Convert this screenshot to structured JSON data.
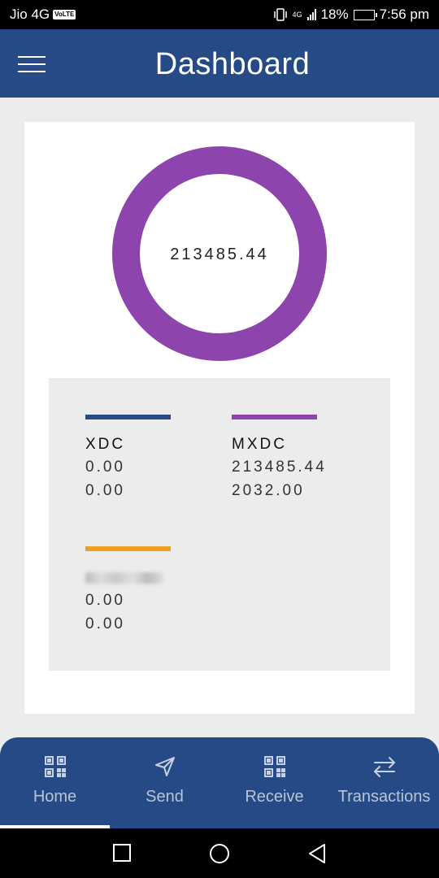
{
  "status_bar": {
    "carrier": "Jio 4G",
    "volte": "VoLTE",
    "network": "4G",
    "battery_percent": "18%",
    "time": "7:56 pm"
  },
  "header": {
    "title": "Dashboard"
  },
  "summary": {
    "total": "213485.44",
    "ring_color": "#8e44ad"
  },
  "assets": [
    {
      "name": "XDC",
      "color": "#254a86",
      "line1": "0.00",
      "line2": "0.00"
    },
    {
      "name": "MXDC",
      "color": "#8e44ad",
      "line1": "213485.44",
      "line2": "2032.00"
    },
    {
      "name": "",
      "color": "#f0a020",
      "line1": "0.00",
      "line2": "0.00"
    }
  ],
  "bottom_nav": {
    "items": [
      {
        "label": "Home",
        "icon": "qr-code-icon",
        "active": true
      },
      {
        "label": "Send",
        "icon": "send-arrow-icon",
        "active": false
      },
      {
        "label": "Receive",
        "icon": "qr-code-icon",
        "active": false
      },
      {
        "label": "Transactions",
        "icon": "swap-arrows-icon",
        "active": false
      }
    ]
  },
  "system_nav": [
    "recents-icon",
    "home-circle-icon",
    "back-triangle-icon"
  ]
}
